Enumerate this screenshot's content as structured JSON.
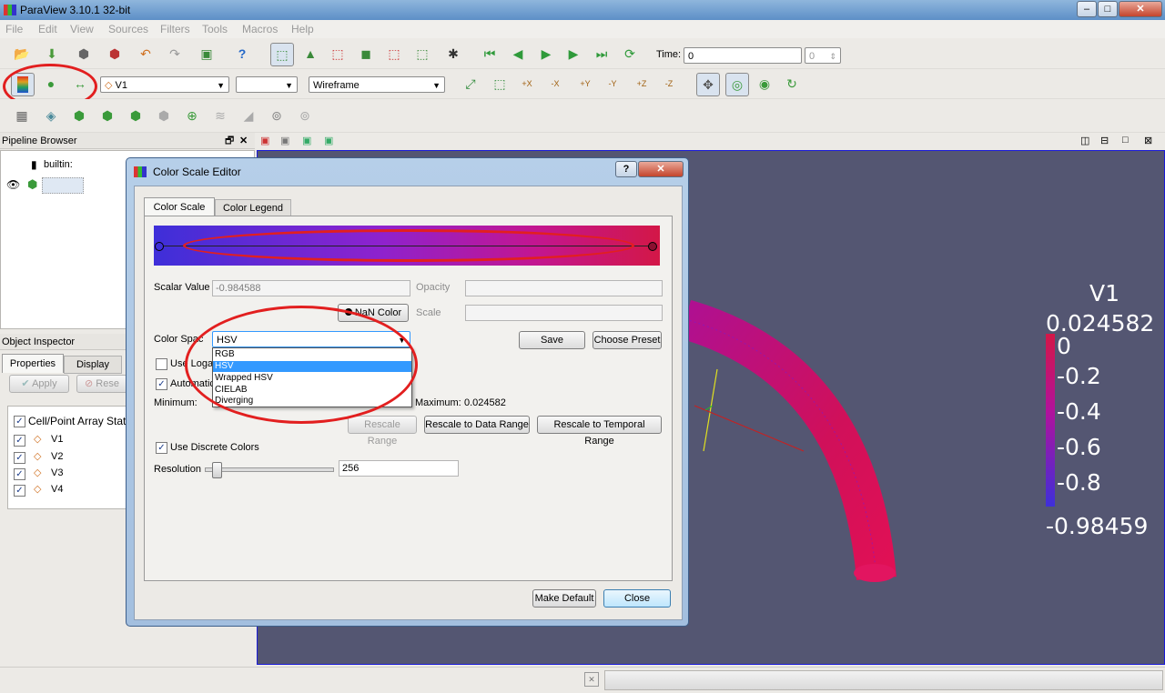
{
  "window": {
    "title": "ParaView 3.10.1 32-bit"
  },
  "menu": [
    "File",
    "Edit",
    "View",
    "Sources",
    "Filters",
    "Tools",
    "Macros",
    "Help"
  ],
  "toolbar": {
    "time_label": "Time:",
    "time_value": "0",
    "time_step": "0",
    "array_combo": "V1",
    "component_combo": "",
    "representation_combo": "Wireframe",
    "axis_buttons": [
      "+X",
      "-X",
      "+Y",
      "-Y",
      "+Z",
      "-Z"
    ]
  },
  "pipeline_browser": {
    "title": "Pipeline Browser",
    "root": "builtin:"
  },
  "object_inspector": {
    "title": "Object Inspector",
    "tabs": [
      "Properties",
      "Display"
    ],
    "apply": "Apply",
    "reset": "Rese",
    "array_header": "Cell/Point Array Stat",
    "arrays": [
      "V1",
      "V2",
      "V3",
      "V4"
    ]
  },
  "dialog": {
    "title": "Color Scale Editor",
    "help": "?",
    "tabs": [
      "Color Scale",
      "Color Legend"
    ],
    "scalar_value_label": "Scalar Value",
    "scalar_value": "-0.984588",
    "opacity_label": "Opacity",
    "nan_color": "NaN Color",
    "scale_label": "Scale",
    "color_space_label": "Color Spac",
    "color_space_value": "HSV",
    "color_space_options": [
      "RGB",
      "HSV",
      "Wrapped HSV",
      "CIELAB",
      "Diverging"
    ],
    "selected_option": "HSV",
    "save": "Save",
    "choose_preset": "Choose Preset",
    "use_log_label": "Use Logar",
    "auto_label": "Automatic",
    "minimum_label": "Minimum:",
    "maximum_label": "Maximum:",
    "maximum_value": "0.024582",
    "rescale_range": "Rescale Range",
    "rescale_data": "Rescale to Data Range",
    "rescale_temporal": "Rescale to Temporal Range",
    "discrete_label": "Use Discrete Colors",
    "resolution_label": "Resolution",
    "resolution_value": "256",
    "resolution_slider_fraction": 0.05,
    "make_default": "Make Default",
    "close": "Close"
  },
  "legend": {
    "title": "V1",
    "max": "0.024582",
    "ticks": [
      "0",
      "-0.2",
      "-0.4",
      "-0.6",
      "-0.8"
    ],
    "min": "-0.98459"
  },
  "colors": {
    "accent": "#3399ff",
    "annotation_red": "#e21f1f",
    "viewport_bg": "#545672",
    "gradient_low": "#3e2fd9",
    "gradient_high": "#d31747"
  }
}
